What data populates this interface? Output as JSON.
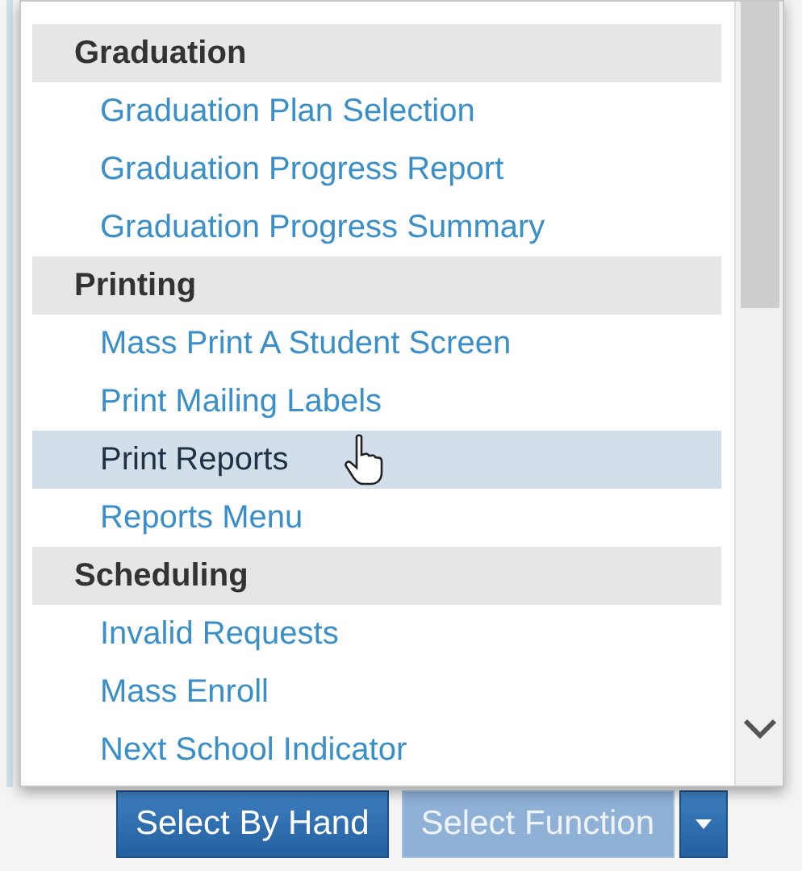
{
  "menu": {
    "groups": [
      {
        "heading": "Graduation",
        "items": [
          {
            "label": "Graduation Plan Selection",
            "selected": false
          },
          {
            "label": "Graduation Progress Report",
            "selected": false
          },
          {
            "label": "Graduation Progress Summary",
            "selected": false
          }
        ]
      },
      {
        "heading": "Printing",
        "items": [
          {
            "label": "Mass Print A Student Screen",
            "selected": false
          },
          {
            "label": "Print Mailing Labels",
            "selected": false
          },
          {
            "label": "Print Reports",
            "selected": true
          },
          {
            "label": "Reports Menu",
            "selected": false
          }
        ]
      },
      {
        "heading": "Scheduling",
        "items": [
          {
            "label": "Invalid Requests",
            "selected": false
          },
          {
            "label": "Mass Enroll",
            "selected": false
          },
          {
            "label": "Next School Indicator",
            "selected": false
          }
        ]
      }
    ]
  },
  "buttons": [
    {
      "label": "Select By Hand",
      "disabled": false
    },
    {
      "label": "Select Function",
      "disabled": true
    }
  ],
  "split_toggle": {
    "disabled": false
  }
}
